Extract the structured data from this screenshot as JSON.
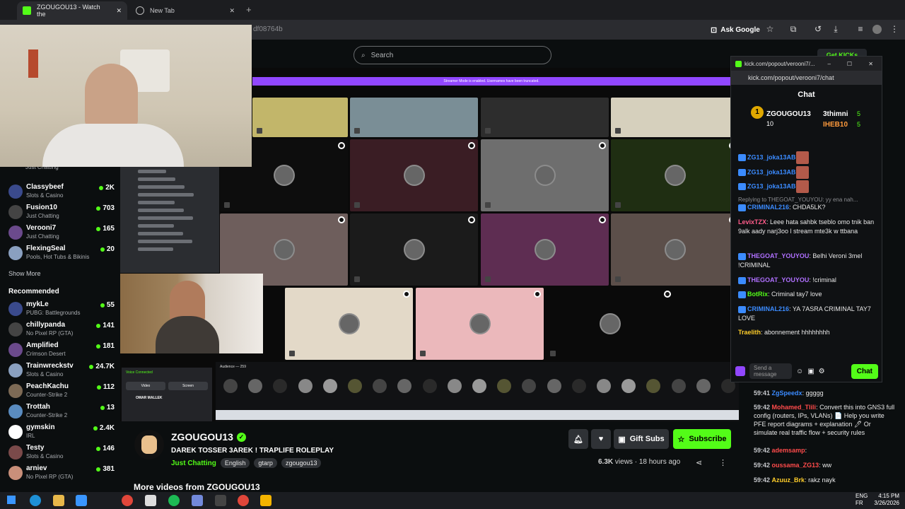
{
  "browser": {
    "tab1": "ZGOUGOU13 - Watch the",
    "tab2": "New Tab",
    "url": "df08764b",
    "ask_google": "Ask Google"
  },
  "header": {
    "search_placeholder": "Search",
    "get_kicks": "Get KICKs"
  },
  "sidebar": {
    "followed": [
      {
        "name": "Classybeef",
        "category": "Slots & Casino",
        "viewers": "2K"
      },
      {
        "name": "Fusion10",
        "category": "Just Chatting",
        "viewers": "703"
      },
      {
        "name": "Verooni7",
        "category": "Just Chatting",
        "viewers": "165"
      },
      {
        "name": "FlexingSeal",
        "category": "Pools, Hot Tubs & Bikinis",
        "viewers": "20"
      }
    ],
    "top_partial_category": "Just Chatting",
    "show_more": "Show More",
    "recommended_title": "Recommended",
    "recommended": [
      {
        "name": "mykLe",
        "category": "PUBG: Battlegrounds",
        "viewers": "55"
      },
      {
        "name": "chillypanda",
        "category": "No Pixel RP (GTA)",
        "viewers": "141"
      },
      {
        "name": "Amplified",
        "category": "Crimson Desert",
        "viewers": "181"
      },
      {
        "name": "Trainwreckstv",
        "category": "Slots & Casino",
        "viewers": "24.7K"
      },
      {
        "name": "PeachKachu",
        "category": "Counter-Strike 2",
        "viewers": "112"
      },
      {
        "name": "Trottah",
        "category": "Counter-Strike 2",
        "viewers": "13"
      },
      {
        "name": "gymskin",
        "category": "IRL",
        "viewers": "2.4K"
      },
      {
        "name": "Testy",
        "category": "Slots & Casino",
        "viewers": "146"
      },
      {
        "name": "arniev",
        "category": "No Pixel RP (GTA)",
        "viewers": "381"
      }
    ]
  },
  "video": {
    "banner": "Streamer Mode is enabled. Usernames have been truncated.",
    "audience": "Audience — 259",
    "vc_title": "Voice Connected",
    "vc_video": "Video",
    "vc_screen": "Screen",
    "vc_user": "OMAR MALLEK"
  },
  "stream": {
    "channel": "ZGOUGOU13",
    "title": "DAREK TOSSER 3AREK ! TRAPLIFE ROLEPLAY",
    "category": "Just Chatting",
    "tags": [
      "English",
      "gtarp",
      "zgougou13"
    ],
    "views": "6.3K",
    "views_label": "views",
    "ago": "18 hours ago",
    "gift_subs": "Gift Subs",
    "subscribe": "Subscribe",
    "more_videos": "More videos from ZGOUGOU13"
  },
  "popout": {
    "window_title": "kick.com/popout/verooni7/...",
    "url": "kick.com/popout/verooni7/chat",
    "chat_title": "Chat",
    "gifters": [
      {
        "name": "ZGOUGOU13",
        "count": "10"
      },
      {
        "name": "3thimni",
        "count": "5"
      },
      {
        "name": "IHEB10",
        "count": "5"
      }
    ],
    "messages": [
      {
        "user": "ZG13_joka13AB",
        "text": ""
      },
      {
        "user": "ZG13_joka13AB",
        "text": ""
      },
      {
        "user": "ZG13_joka13AB",
        "text": ""
      },
      {
        "user": "",
        "text": "Replying to THEGOAT_YOUYOU: yy ena nah..."
      },
      {
        "user": "CRIMINAL216",
        "text": ": CHDA5LK?"
      },
      {
        "user": "LevixTZX",
        "text": ": Leee hata sahbk tseblo omo tnik ban 9alk aady narj3oo l stream mte3k w ttbana"
      },
      {
        "user": "THEGOAT_YOUYOU",
        "text": ": Belhi Veroni 3mel !CRIMINAL"
      },
      {
        "user": "THEGOAT_YOUYOU",
        "text": ": !criminal"
      },
      {
        "user": "BotRix",
        "text": ": Criminal tay7 love"
      },
      {
        "user": "CRIMINAL216",
        "text": ": YA 7ASRA CRIMINAL TAY7 LOVE"
      },
      {
        "user": "Traelith",
        "text": ": abonnement hhhhhhhh"
      }
    ],
    "send_placeholder": "Send a message",
    "chat_button": "Chat"
  },
  "lower_chat": [
    {
      "time": "59:41",
      "user": "ZgSpeedx",
      "text": ": ggggg",
      "color": "#3b8bff"
    },
    {
      "time": "59:42",
      "user": "Mohamed_Tlili",
      "text": ": Convert this into GNS3 full config (routers, IPs, VLANs) 📄 Help you write PFE report diagrams + explanation 🖊 Or simulate real traffic flow + security rules",
      "color": "#ff4b4b"
    },
    {
      "time": "59:42",
      "user": "ademsamp",
      "text": ":",
      "color": "#ff4b4b"
    },
    {
      "time": "59:42",
      "user": "oussama_ZG13",
      "text": ": ww",
      "color": "#ff4b4b"
    },
    {
      "time": "59:42",
      "user": "Azuuz_Brk",
      "text": ": rakz nayk",
      "color": "#ffce2a"
    }
  ],
  "taskbar": {
    "lang1": "ENG",
    "lang2": "FR",
    "time": "4:15 PM",
    "date": "3/26/2026"
  }
}
